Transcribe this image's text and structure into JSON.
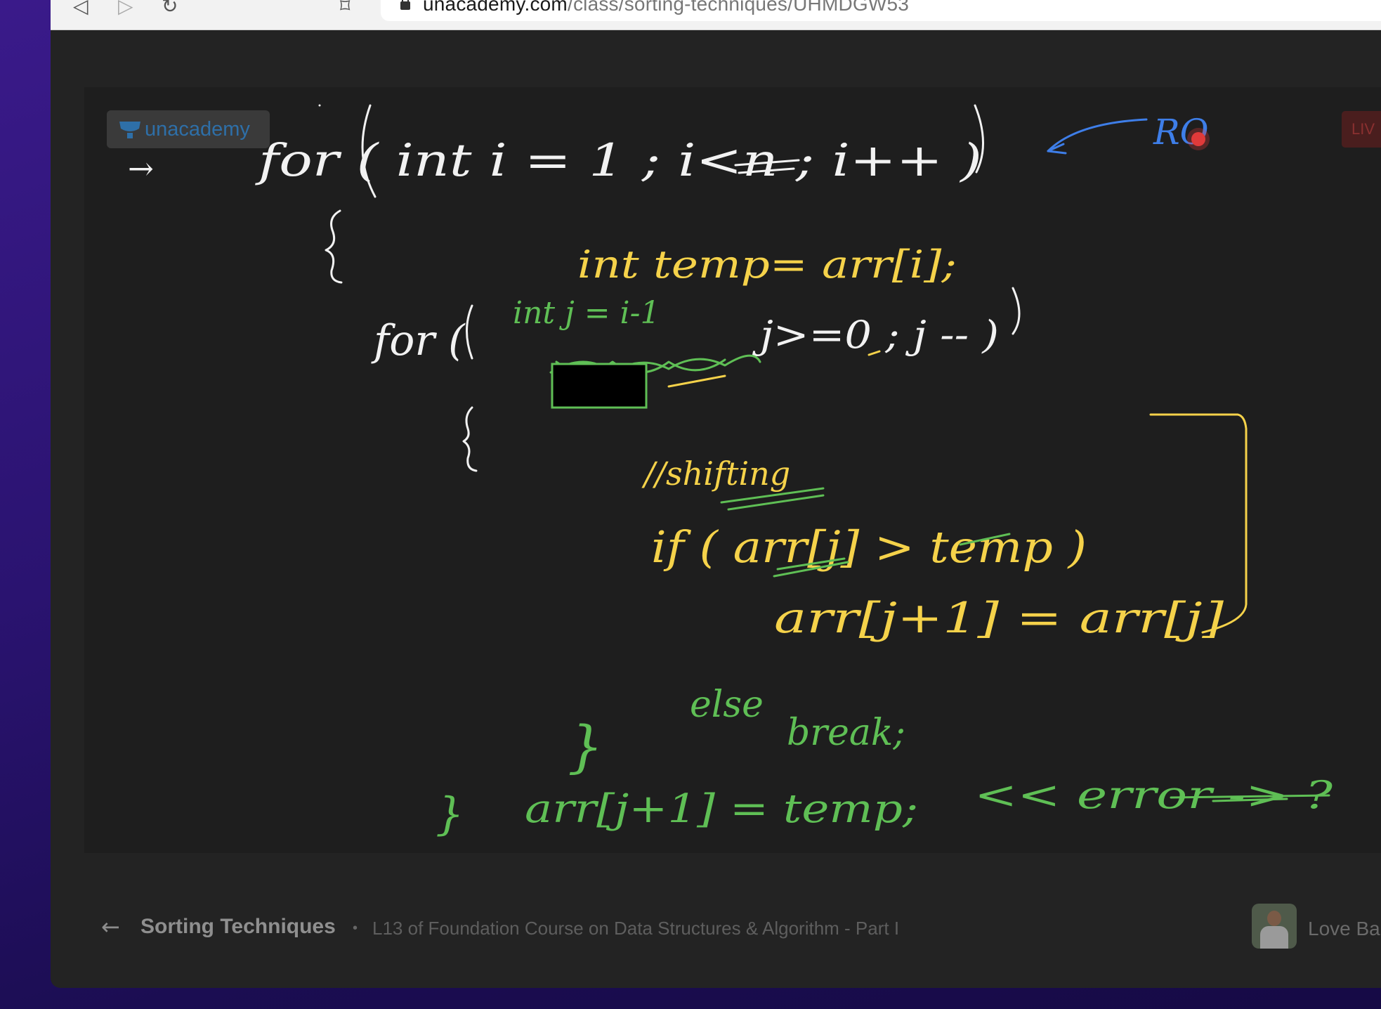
{
  "browser": {
    "url_host": "unacademy.com",
    "url_path": "/class/sorting-techniques/UHMDGW53"
  },
  "logo": {
    "text": "unacademy"
  },
  "live_badge": {
    "text": "LIV"
  },
  "whiteboard": {
    "colors": {
      "white": "#f2f2f2",
      "yellow": "#f5d24a",
      "green": "#5fbf55",
      "blue": "#3e7ee8",
      "pointer": "#e03a3a"
    },
    "lines": {
      "arrow_marker": "→",
      "for_outer": "for ( int i = 1 ; i<n ; i++ )",
      "annotation_blue": "RO",
      "brace_open_outer": "{",
      "temp_decl": "int temp= arr[i];",
      "green_init": "int j = i-1",
      "for_inner_start": "for (",
      "for_inner_cond": "j>=0 ; j -- )",
      "brace_open_inner": "{",
      "comment_shift": "//shifting",
      "if_line": "if ( arr[j] > temp )",
      "assign_line": "arr[j+1] = arr[j]",
      "else_word": "else",
      "break_word": "break;",
      "brace_close_inner": "}",
      "brace_close_outer": "}",
      "final_assign": "arr[j+1] = temp;",
      "error_note": "<< error -> ?"
    }
  },
  "footer": {
    "back_icon": "←",
    "class_title": "Sorting Techniques",
    "separator": "•",
    "course_subtitle": "L13 of Foundation Course on Data Structures & Algorithm - Part I",
    "instructor": "Love Ba"
  }
}
